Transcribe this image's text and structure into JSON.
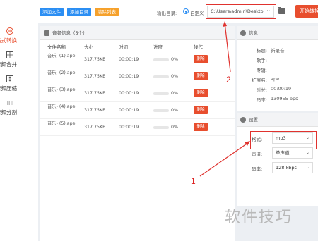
{
  "sidebar": {
    "items": [
      {
        "label": "格式转换",
        "icon": "convert-icon",
        "active": true
      },
      {
        "label": "音频合并",
        "icon": "merge-icon",
        "active": false
      },
      {
        "label": "音频压缩",
        "icon": "compress-icon",
        "active": false
      },
      {
        "label": "音频分割",
        "icon": "split-icon",
        "active": false
      }
    ]
  },
  "toolbar": {
    "add_file": "添加文件",
    "add_dir": "添加目录",
    "clear_list": "清除列表",
    "output_label": "输出目录:",
    "custom_label": "自定义",
    "output_path": "C:\\Users\\admin\\Deskto",
    "more_label": "···",
    "start_label": "开始转换"
  },
  "file_panel": {
    "title": "音频信息（5个）",
    "columns": [
      "文件名称",
      "大小",
      "时间",
      "进度",
      "操作"
    ],
    "rows": [
      {
        "name": "音乐- (1).ape",
        "size": "317.75KB",
        "time": "00:00:19",
        "progress": "0%",
        "action": "删除"
      },
      {
        "name": "音乐- (2).ape",
        "size": "317.75KB",
        "time": "00:00:19",
        "progress": "0%",
        "action": "删除"
      },
      {
        "name": "音乐- (3).ape",
        "size": "317.75KB",
        "time": "00:00:19",
        "progress": "0%",
        "action": "删除"
      },
      {
        "name": "音乐- (4).ape",
        "size": "317.75KB",
        "time": "00:00:19",
        "progress": "0%",
        "action": "删除"
      },
      {
        "name": "音乐- (5).ape",
        "size": "317.75KB",
        "time": "00:00:19",
        "progress": "0%",
        "action": "删除"
      }
    ]
  },
  "info_panel": {
    "title": "信息",
    "rows": [
      {
        "key": "标题:",
        "value": "新录音"
      },
      {
        "key": "歌手:",
        "value": ""
      },
      {
        "key": "专辑:",
        "value": ""
      },
      {
        "key": "扩展名:",
        "value": "ape"
      },
      {
        "key": "时长:",
        "value": "00:00:19"
      },
      {
        "key": "码率:",
        "value": "130955 bps"
      }
    ]
  },
  "settings_panel": {
    "title": "设置",
    "format_label": "格式:",
    "format_value": "mp3",
    "channel_label": "声道:",
    "channel_value": "单声道",
    "bitrate_label": "码率:",
    "bitrate_value": "128 kbps"
  },
  "annotations": {
    "one": "1",
    "two": "2"
  },
  "watermark": "软件技巧",
  "colors": {
    "accent": "#e84e2e",
    "blue": "#2b8ef3",
    "orange": "#f6a12b",
    "annotation": "#e0322e"
  }
}
